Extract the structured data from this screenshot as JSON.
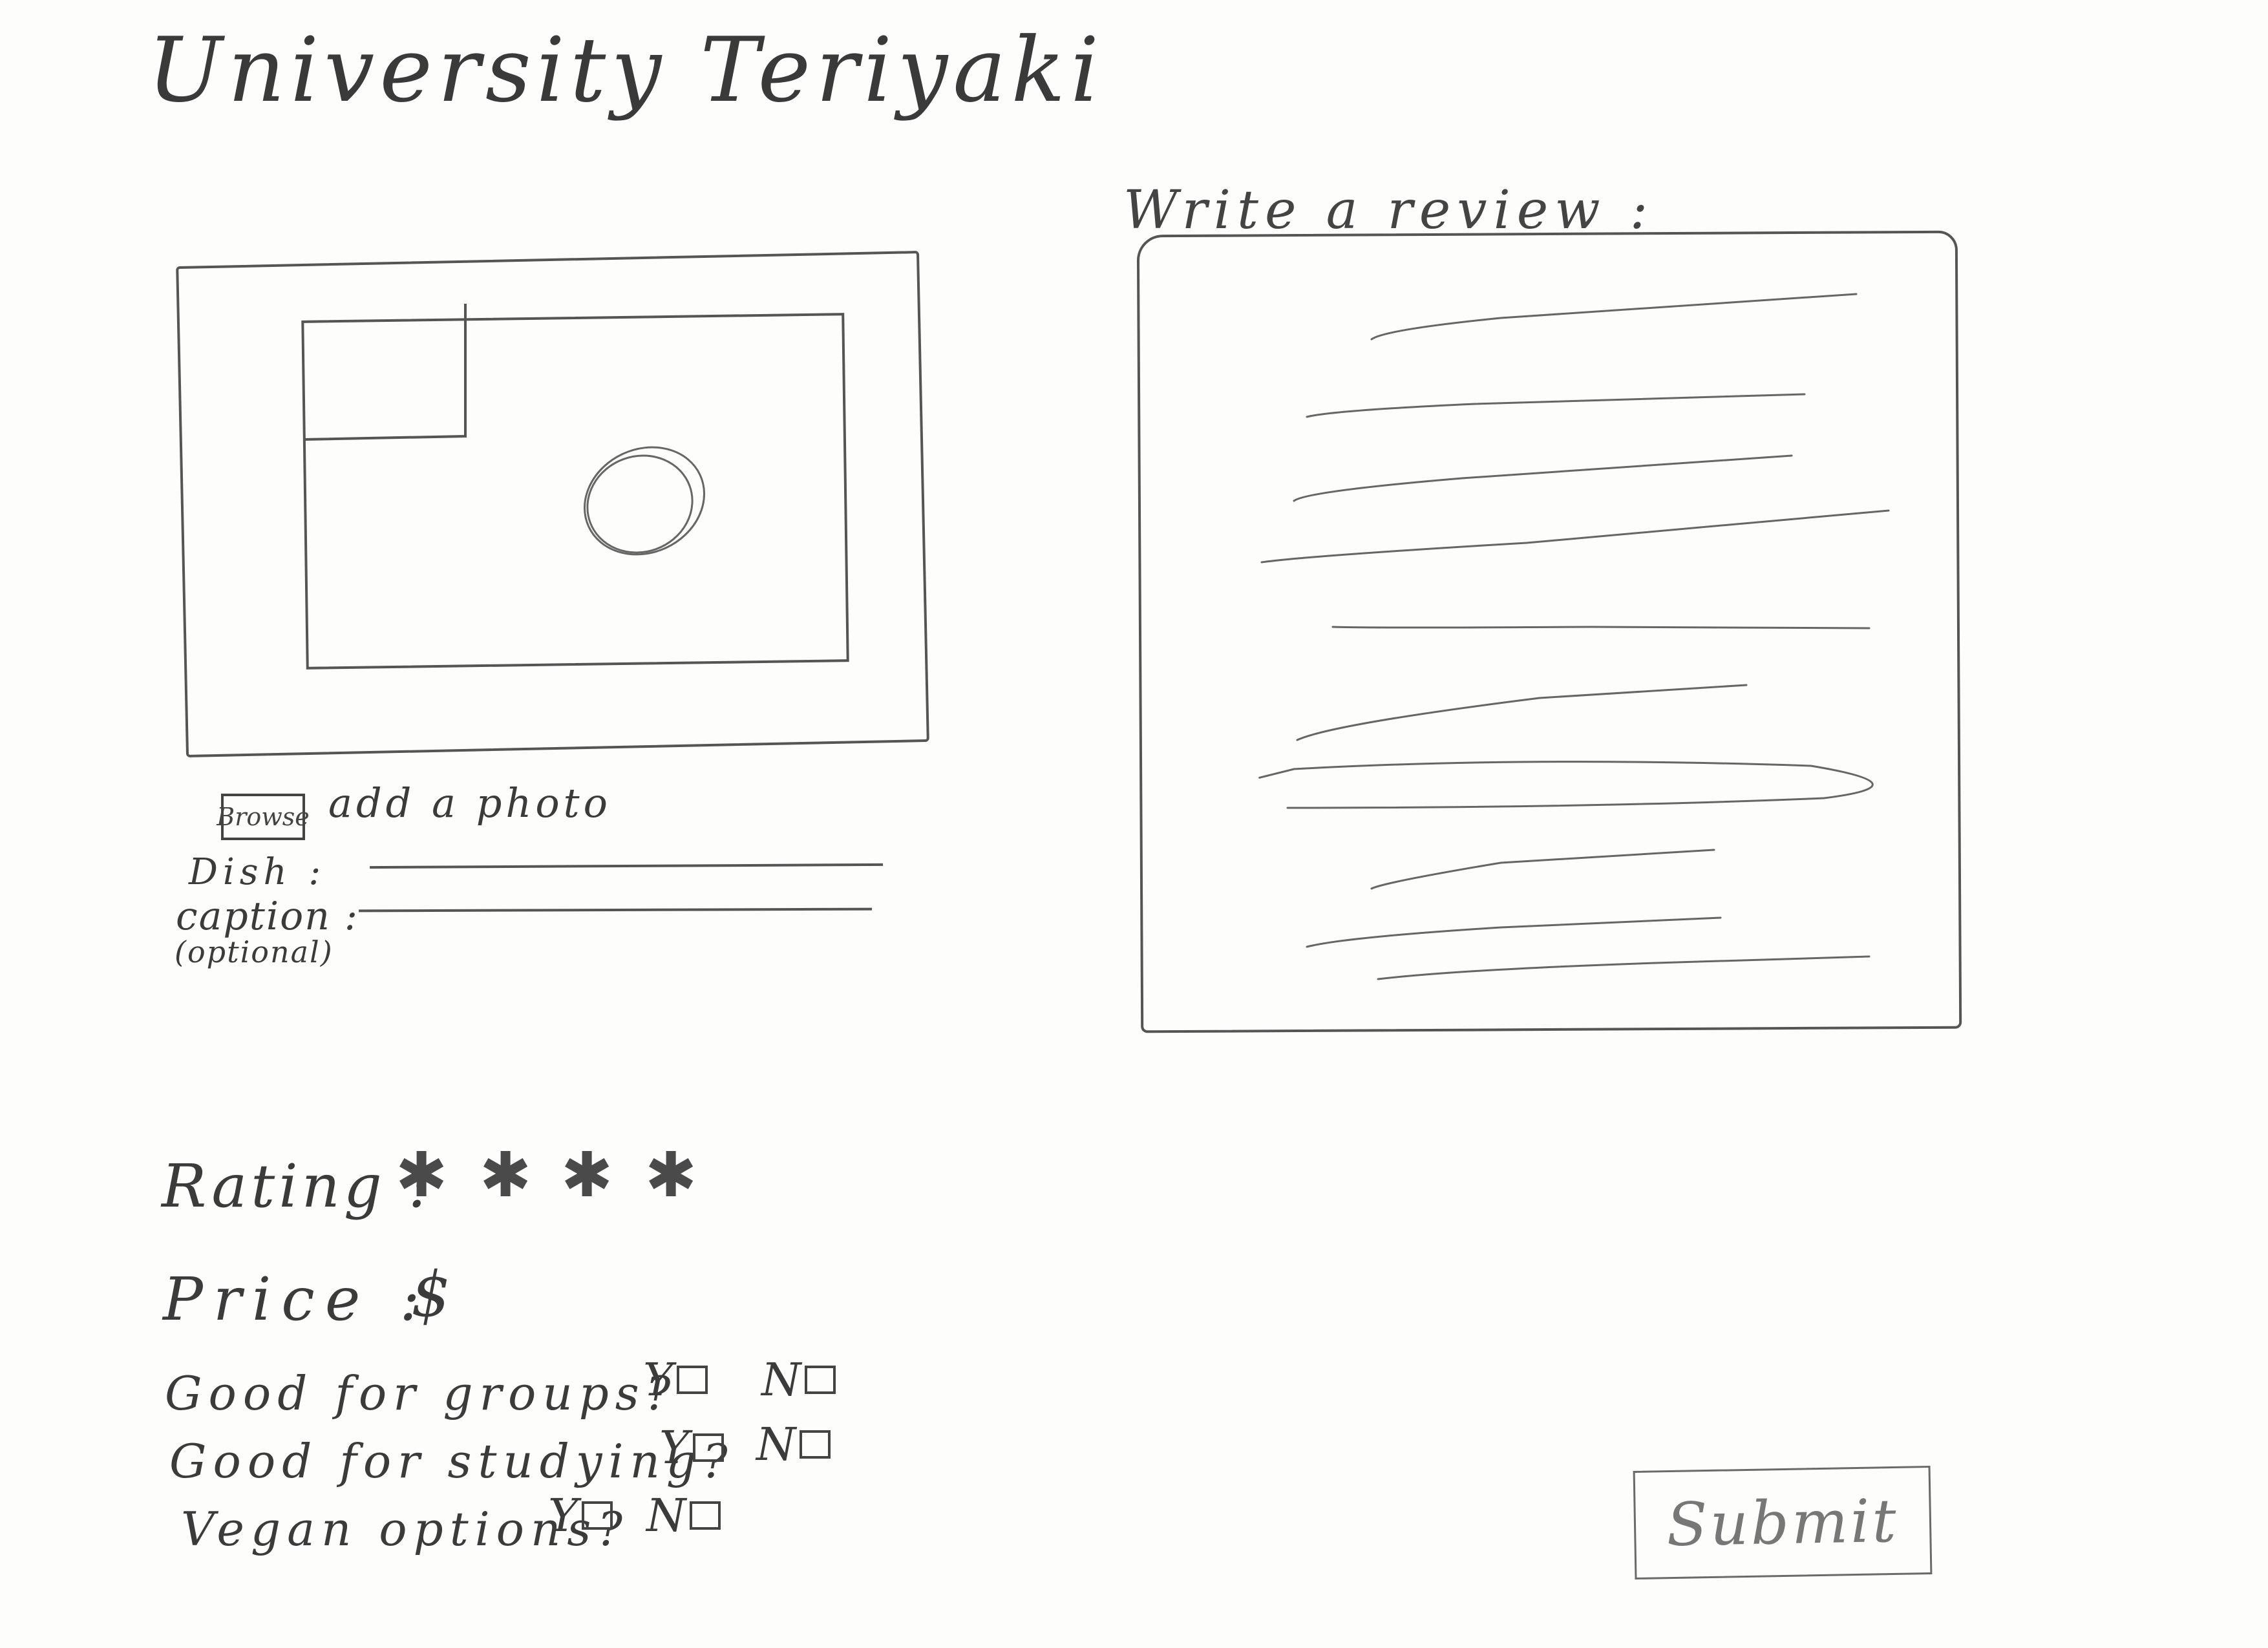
{
  "header": {
    "title": "University Teriyaki"
  },
  "photo": {
    "browse_label": "Browse",
    "add_photo_label": "add a photo",
    "dish_label": "Dish :",
    "caption_label": "caption :",
    "optional_label": "(optional)"
  },
  "review": {
    "heading": "Write a review :"
  },
  "rating": {
    "label": "Rating :",
    "stars_shown": 4,
    "star_glyphs": [
      "✱",
      "✱",
      "✱",
      "✱"
    ]
  },
  "price": {
    "label": "Price :",
    "value": "$"
  },
  "questions": [
    {
      "label": "Good for groups?",
      "yes": "Y",
      "no": "N"
    },
    {
      "label": "Good for studying?",
      "yes": "Y",
      "no": "N"
    },
    {
      "label": "Vegan options?",
      "yes": "Y",
      "no": "N"
    }
  ],
  "submit": {
    "label": "Submit"
  },
  "icons": {
    "photo_placeholder": "image-icon"
  },
  "colors": {
    "pencil": "#444444",
    "paper": "#fdfdfc"
  }
}
